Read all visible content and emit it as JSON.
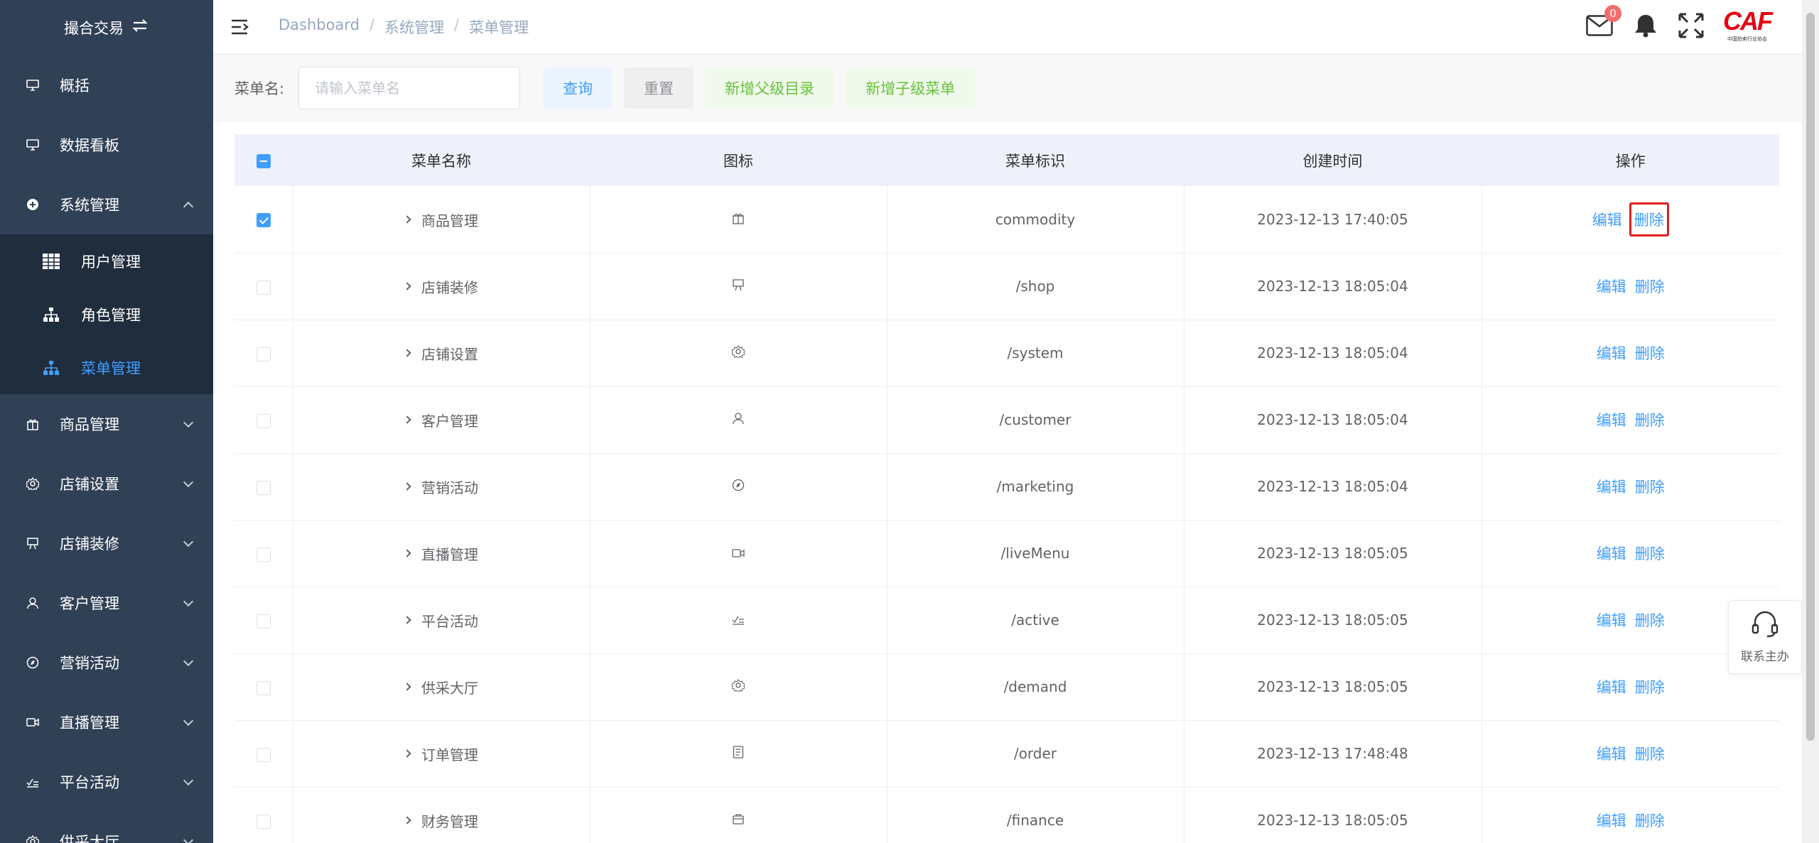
{
  "sidebar": {
    "brand": "撮合交易",
    "items": [
      {
        "label": "概括",
        "icon": "monitor-icon"
      },
      {
        "label": "数据看板",
        "icon": "monitor-icon"
      },
      {
        "label": "系统管理",
        "icon": "plus-circle-icon"
      },
      {
        "label": "商品管理",
        "icon": "gift-icon"
      },
      {
        "label": "店铺设置",
        "icon": "gear-icon"
      },
      {
        "label": "店铺装修",
        "icon": "easel-icon"
      },
      {
        "label": "客户管理",
        "icon": "user-icon"
      },
      {
        "label": "营销活动",
        "icon": "compass-icon"
      },
      {
        "label": "直播管理",
        "icon": "video-camera-icon"
      },
      {
        "label": "平台活动",
        "icon": "checklist-icon"
      },
      {
        "label": "供采大厅",
        "icon": "gear-icon"
      }
    ],
    "sub_items": [
      {
        "label": "用户管理",
        "icon": "grid-table-icon"
      },
      {
        "label": "角色管理",
        "icon": "tree-icon"
      },
      {
        "label": "菜单管理",
        "icon": "tree-icon"
      }
    ]
  },
  "header": {
    "breadcrumb": [
      "Dashboard",
      "系统管理",
      "菜单管理"
    ],
    "breadcrumb_sep": "/",
    "mail_badge": "0",
    "logo_text": "CAF",
    "logo_subtext": "中国拍卖行业协会"
  },
  "toolbar": {
    "label": "菜单名:",
    "placeholder": "请输入菜单名",
    "query": "查询",
    "reset": "重置",
    "add_parent": "新增父级目录",
    "add_child": "新增子级菜单"
  },
  "table": {
    "columns": [
      "菜单名称",
      "图标",
      "菜单标识",
      "创建时间",
      "操作"
    ],
    "edit_label": "编辑",
    "delete_label": "删除",
    "rows": [
      {
        "name": "商品管理",
        "icon": "gift-icon",
        "key": "commodity",
        "time": "2023-12-13 17:40:05",
        "checked": true
      },
      {
        "name": "店铺装修",
        "icon": "easel-icon",
        "key": "/shop",
        "time": "2023-12-13 18:05:04",
        "checked": false
      },
      {
        "name": "店铺设置",
        "icon": "gear-icon",
        "key": "/system",
        "time": "2023-12-13 18:05:04",
        "checked": false
      },
      {
        "name": "客户管理",
        "icon": "user-icon",
        "key": "/customer",
        "time": "2023-12-13 18:05:04",
        "checked": false
      },
      {
        "name": "营销活动",
        "icon": "compass-icon",
        "key": "/marketing",
        "time": "2023-12-13 18:05:04",
        "checked": false
      },
      {
        "name": "直播管理",
        "icon": "video-camera-icon",
        "key": "/liveMenu",
        "time": "2023-12-13 18:05:05",
        "checked": false
      },
      {
        "name": "平台活动",
        "icon": "checklist-icon",
        "key": "/active",
        "time": "2023-12-13 18:05:05",
        "checked": false
      },
      {
        "name": "供采大厅",
        "icon": "gear-icon",
        "key": "/demand",
        "time": "2023-12-13 18:05:05",
        "checked": false
      },
      {
        "name": "订单管理",
        "icon": "document-icon",
        "key": "/order",
        "time": "2023-12-13 17:48:48",
        "checked": false
      },
      {
        "name": "财务管理",
        "icon": "wallet-icon",
        "key": "/finance",
        "time": "2023-12-13 18:05:05",
        "checked": false
      }
    ]
  },
  "contact": {
    "label": "联系主办"
  },
  "colors": {
    "sidebar_bg": "#304156",
    "submenu_bg": "#1f2d3d",
    "accent": "#409eff",
    "success": "#67c23a",
    "highlight": "#e02020"
  }
}
